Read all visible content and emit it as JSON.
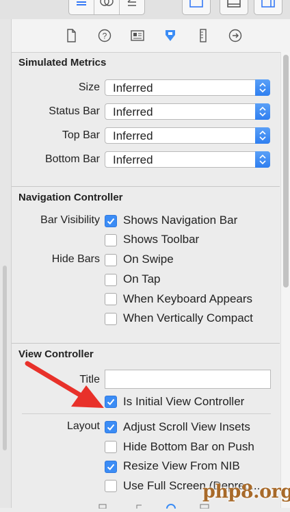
{
  "inspector": {
    "tabs": [
      {
        "name": "file-inspector",
        "icon": "document-icon"
      },
      {
        "name": "quick-help",
        "icon": "help-icon"
      },
      {
        "name": "identity-inspector",
        "icon": "identity-card-icon"
      },
      {
        "name": "attributes-inspector",
        "icon": "attributes-icon",
        "selected": true
      },
      {
        "name": "size-inspector",
        "icon": "ruler-icon"
      },
      {
        "name": "connections-inspector",
        "icon": "arrow-circle-icon"
      }
    ],
    "accent_color": "#3b8cf5"
  },
  "simulated_metrics": {
    "title": "Simulated Metrics",
    "size_label": "Size",
    "size_value": "Inferred",
    "status_bar_label": "Status Bar",
    "status_bar_value": "Inferred",
    "top_bar_label": "Top Bar",
    "top_bar_value": "Inferred",
    "bottom_bar_label": "Bottom Bar",
    "bottom_bar_value": "Inferred"
  },
  "navigation_controller": {
    "title": "Navigation Controller",
    "bar_visibility_label": "Bar Visibility",
    "shows_navigation_bar": {
      "label": "Shows Navigation Bar",
      "checked": true
    },
    "shows_toolbar": {
      "label": "Shows Toolbar",
      "checked": false
    },
    "hide_bars_label": "Hide Bars",
    "on_swipe": {
      "label": "On Swipe",
      "checked": false
    },
    "on_tap": {
      "label": "On Tap",
      "checked": false
    },
    "when_keyboard_appears": {
      "label": "When Keyboard Appears",
      "checked": false
    },
    "when_vertically_compact": {
      "label": "When Vertically Compact",
      "checked": false
    }
  },
  "view_controller": {
    "title": "View Controller",
    "title_field_label": "Title",
    "title_field_value": "",
    "is_initial": {
      "label": "Is Initial View Controller",
      "checked": true
    },
    "layout_label": "Layout",
    "adjust_scroll_view_insets": {
      "label": "Adjust Scroll View Insets",
      "checked": true
    },
    "hide_bottom_bar_on_push": {
      "label": "Hide Bottom Bar on Push",
      "checked": false
    },
    "resize_view_from_nib": {
      "label": "Resize View From NIB",
      "checked": true
    },
    "use_full_screen": {
      "label": "Use Full Screen (Deprec...",
      "checked": false
    }
  },
  "watermark": "php8.org",
  "annotation_arrow_color": "#e8312a"
}
